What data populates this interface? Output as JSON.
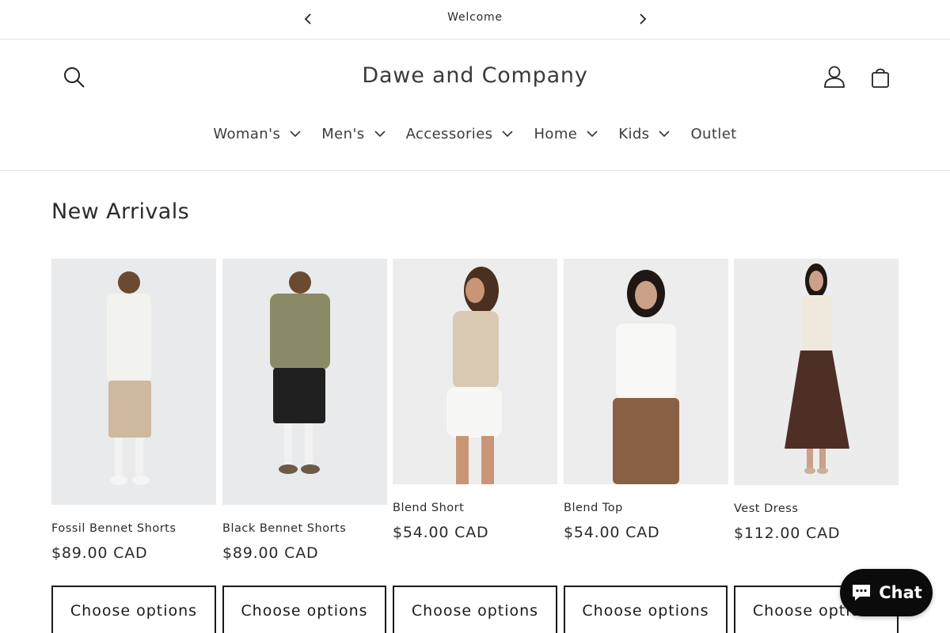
{
  "announcement": {
    "message": "Welcome"
  },
  "header": {
    "brand": "Dawe and Company"
  },
  "nav": {
    "items": [
      {
        "label": "Woman's",
        "has_dropdown": true
      },
      {
        "label": "Men's",
        "has_dropdown": true
      },
      {
        "label": "Accessories",
        "has_dropdown": true
      },
      {
        "label": "Home",
        "has_dropdown": true
      },
      {
        "label": "Kids",
        "has_dropdown": true
      },
      {
        "label": "Outlet",
        "has_dropdown": false
      }
    ]
  },
  "section": {
    "title": "New Arrivals"
  },
  "products": [
    {
      "title": "Fossil Bennet Shorts",
      "price": "$89.00 CAD",
      "button": "Choose options",
      "top_color": "#f2f2ef",
      "bottom_color": "#cdb99f",
      "shoe_color": "#f5f5f5"
    },
    {
      "title": "Black Bennet Shorts",
      "price": "$89.00 CAD",
      "button": "Choose options",
      "top_color": "#8a8a66",
      "bottom_color": "#202020",
      "shoe_color": "#6b5a45"
    },
    {
      "title": "Blend Short",
      "price": "$54.00 CAD",
      "button": "Choose options",
      "top_color": "#d9c9b3",
      "bottom_color": "#f7f7f5",
      "shoe_color": "#e0c4a8"
    },
    {
      "title": "Blend Top",
      "price": "$54.00 CAD",
      "button": "Choose options",
      "top_color": "#f8f8f6",
      "bottom_color": "#8a6045",
      "shoe_color": "#d0a88c"
    },
    {
      "title": "Vest Dress",
      "price": "$112.00 CAD",
      "button": "Choose options",
      "top_color": "#efe9dd",
      "bottom_color": "#4e2f25",
      "shoe_color": "#c8b09a"
    }
  ],
  "chat": {
    "label": "Chat"
  },
  "colors": {
    "text": "#121212",
    "border": "#e6e6e6",
    "chat_bg": "#0b0b0b"
  }
}
